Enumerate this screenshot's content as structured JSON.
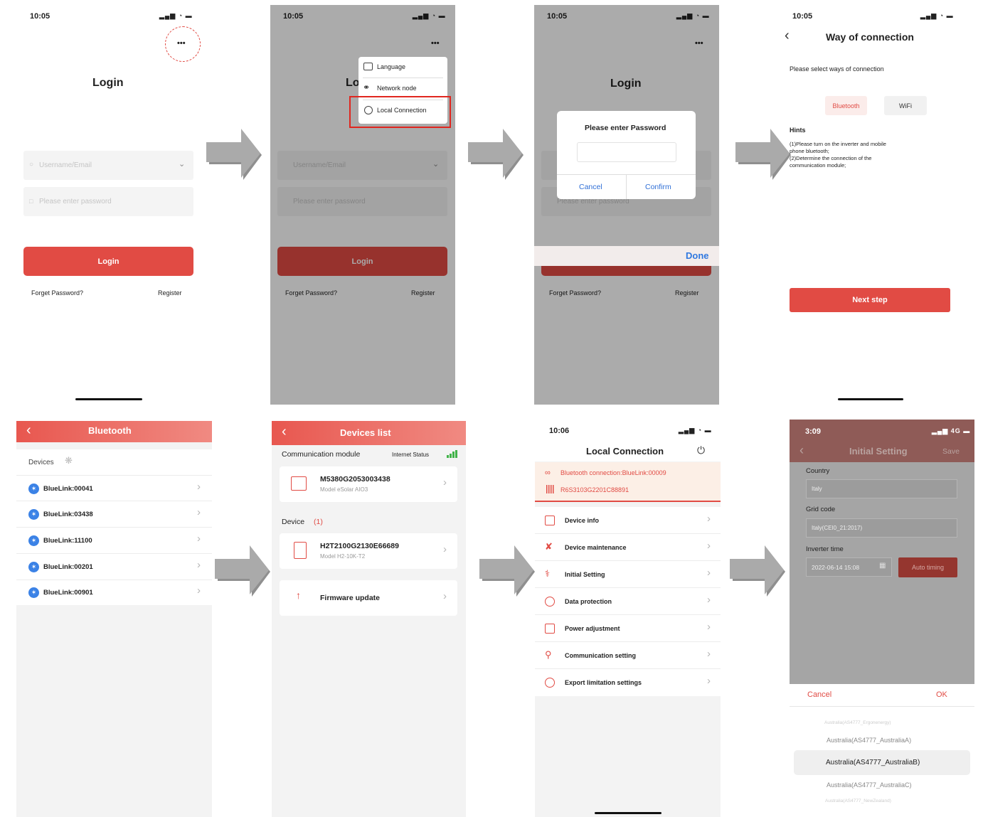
{
  "p1": {
    "time": "10:05",
    "signal": "▂▄▆ ◔ ▬",
    "more": "•••",
    "title": "Login",
    "username_ph": "Username/Email",
    "password_ph": "Please enter password",
    "login": "Login",
    "forget": "Forget Password?",
    "register": "Register"
  },
  "p2": {
    "time": "10:05",
    "signal": "▂▄▆ ◔ ▬",
    "more": "•••",
    "title": "Lo",
    "menu": [
      "Language",
      "Network node",
      "Local Connection"
    ],
    "username_ph": "Username/Email",
    "password_ph": "Please enter password",
    "login": "Login",
    "forget": "Forget Password?",
    "register": "Register"
  },
  "p3": {
    "time": "10:05",
    "signal": "▂▄▆ ◔ ▬",
    "more": "•••",
    "title": "Login",
    "dialog_title": "Please enter Password",
    "cancel": "Cancel",
    "confirm": "Confirm",
    "password_ph": "Please enter password",
    "done": "Done",
    "forget": "Forget Password?",
    "register": "Register"
  },
  "p4": {
    "time": "10:05",
    "signal": "▂▄▆ ◔ ▬",
    "title": "Way of connection",
    "subtitle": "Please select ways of connection",
    "bluetooth": "Bluetooth",
    "wifi": "WiFi",
    "hints_title": "Hints",
    "hint1": "(1)Please turn on the inverter and mobile",
    "hint2": "phone bluetooth;",
    "hint3": "(2)Determine the connection of the",
    "hint4": "communication module;",
    "next": "Next step"
  },
  "p5": {
    "title": "Bluetooth",
    "devices": "Devices",
    "items": [
      "BlueLink:00041",
      "BlueLink:03438",
      "BlueLink:11100",
      "BlueLink:00201",
      "BlueLink:00901"
    ]
  },
  "p6": {
    "title": "Devices list",
    "comm": "Communication module",
    "internet": "Internet Status",
    "module_sn": "M5380G2053003438",
    "module_model": "Model  eSolar AIO3",
    "device": "Device",
    "device_count": "(1)",
    "dev_sn": "H2T2100G2130E66689",
    "dev_model": "Model  H2-10K-T2",
    "firmware": "Firmware update"
  },
  "p7": {
    "time": "10:06",
    "signal": "▂▄▆ ◔ ▬",
    "title": "Local Connection",
    "bt_conn": "Bluetooth connection:BlueLink:00009",
    "sn": "R6S3103G2201C88891",
    "items": [
      "Device info",
      "Device maintenance",
      "Initial Setting",
      "Data protection",
      "Power adjustment",
      "Communication setting",
      "Export limitation settings"
    ]
  },
  "p8": {
    "time": "3:09",
    "signal": "▂▄▆ 4G ▬",
    "title": "Initial Setting",
    "save": "Save",
    "country": "Country",
    "country_val": "Italy",
    "grid": "Grid code",
    "grid_val": "Italy(CEI0_21:2017)",
    "inv_time": "Inverter time",
    "time_val": "2022-06-14 15:08",
    "auto": "Auto timing",
    "cancel": "Cancel",
    "ok": "OK",
    "picker": [
      "Australia(AS4777_Ergonenergy)",
      "Australia(AS4777_AustraliaA)",
      "Australia(AS4777_AustraliaB)",
      "Australia(AS4777_AustraliaC)",
      "Australia(AS4777_NewZealand)"
    ]
  },
  "colors": {
    "accent": "#e14b44",
    "blue": "#3b82e6"
  }
}
